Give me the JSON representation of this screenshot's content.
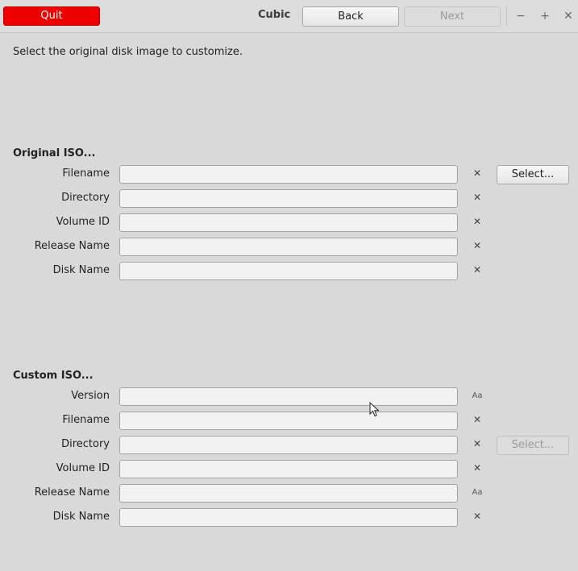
{
  "header": {
    "quit_label": "Quit",
    "app_title": "Cubic",
    "back_label": "Back",
    "next_label": "Next",
    "minimize_glyph": "−",
    "maximize_glyph": "+",
    "close_glyph": "✕"
  },
  "instruction": "Select the original disk image to customize.",
  "original": {
    "heading": "Original ISO...",
    "select_label": "Select...",
    "fields": [
      {
        "label": "Filename",
        "value": "",
        "action": "clear-icon"
      },
      {
        "label": "Directory",
        "value": "",
        "action": "clear-icon"
      },
      {
        "label": "Volume ID",
        "value": "",
        "action": "clear-icon"
      },
      {
        "label": "Release Name",
        "value": "",
        "action": "clear-icon"
      },
      {
        "label": "Disk Name",
        "value": "",
        "action": "clear-icon"
      }
    ]
  },
  "custom": {
    "heading": "Custom ISO...",
    "select_label": "Select...",
    "select_enabled": false,
    "fields": [
      {
        "label": "Version",
        "value": "",
        "action": "text-format-icon"
      },
      {
        "label": "Filename",
        "value": "",
        "action": "clear-icon"
      },
      {
        "label": "Directory",
        "value": "",
        "action": "clear-icon"
      },
      {
        "label": "Volume ID",
        "value": "",
        "action": "clear-icon"
      },
      {
        "label": "Release Name",
        "value": "",
        "action": "text-format-icon"
      },
      {
        "label": "Disk Name",
        "value": "",
        "action": "clear-icon"
      }
    ]
  },
  "icons": {
    "clear_glyph": "✕",
    "format_glyph": "Aa"
  },
  "colors": {
    "quit_bg": "#ee0000",
    "window_bg": "#d9d9d9",
    "field_bg": "#f2f2f2"
  }
}
